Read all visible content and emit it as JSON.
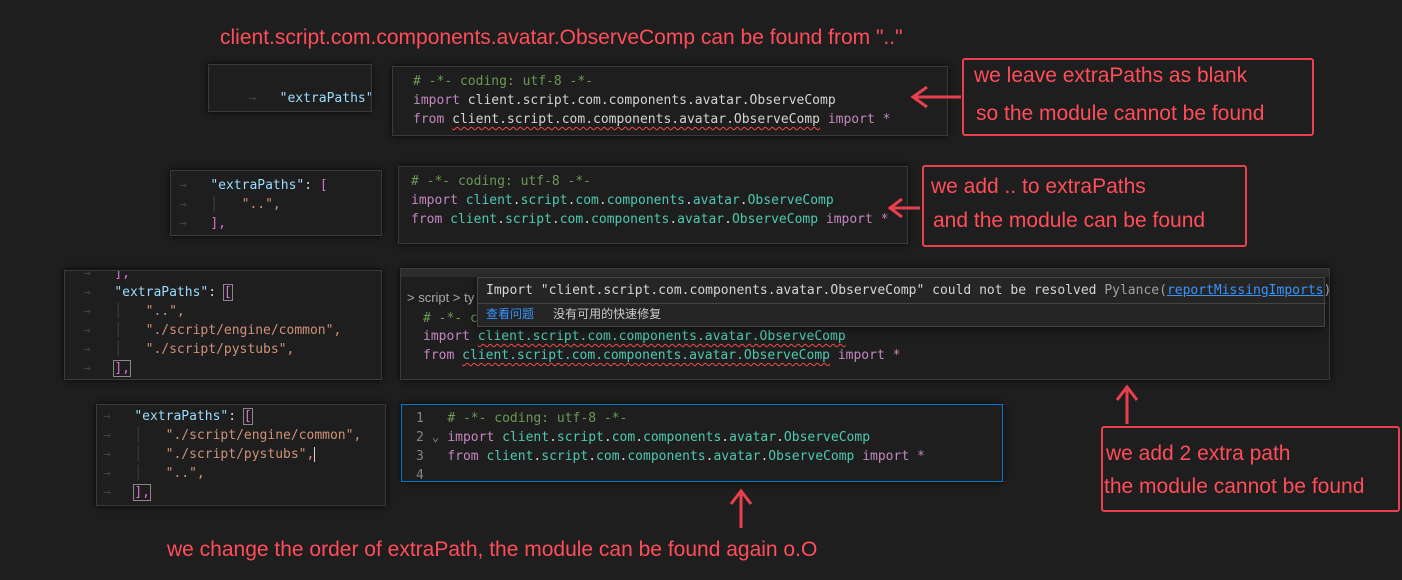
{
  "title_annotation": "client.script.com.components.avatar.ObserveComp can be found from \"..\"",
  "code": {
    "comment": "# -*- coding: utf-8 -*-",
    "import_kw": "import",
    "from_kw": "from",
    "import_star": "import *",
    "path_client": "client",
    "path_script": "script",
    "path_com": "com",
    "path_components": "components",
    "path_avatar": "avatar",
    "path_observe": "ObserveComp",
    "full_path": "client.script.com.components.avatar.ObserveComp"
  },
  "settings": {
    "extra_paths_key": "\"extraPaths\"",
    "colon": ": ",
    "open_bracket": "[",
    "close_bracket": "],",
    "dotdot": "\"..\",",
    "engine_common": "\"./script/engine/common\",",
    "pystubs": "\"./script/pystubs\",",
    "partial_top": "-",
    "partial_close": "],"
  },
  "annotations": {
    "a1_line1": "we leave extraPaths as blank",
    "a1_line2": "so the module cannot be found",
    "a2_line1": "we add .. to extraPaths",
    "a2_line2": "and the module can be found",
    "a3_line1": "we add 2 extra path",
    "a3_line2": " the module cannot be found",
    "a4": "we change the order of extraPath, the module can be found again o.O"
  },
  "breadcrumb": {
    "script": "script",
    "sep": ">",
    "partial": "ty"
  },
  "tooltip": {
    "message": "Import \"client.script.com.components.avatar.ObserveComp\" could not be resolved",
    "source": "Pylance",
    "code_link": "reportMissingImports",
    "view_problem": "查看问题",
    "no_quick_fix": "没有可用的快速修复"
  },
  "line_numbers": [
    "1",
    "2",
    "3",
    "4"
  ],
  "colors": {
    "annotation_red": "#ff4d5a",
    "box_red": "#e8404e",
    "comment_green": "#6a9955",
    "keyword_purple": "#c586c0",
    "module_teal": "#4ec9b0",
    "string_orange": "#ce9178",
    "key_blue": "#9cdcfe",
    "link_blue": "#3794ff",
    "focus_border": "#007acc"
  }
}
